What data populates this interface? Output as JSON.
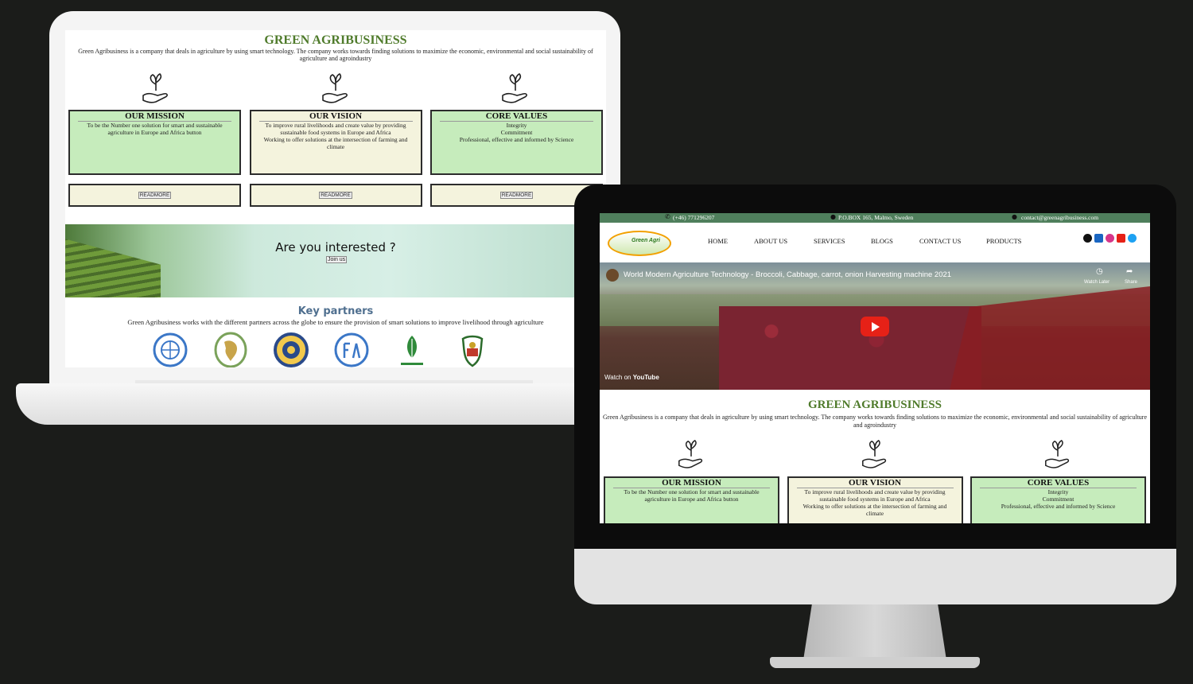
{
  "site": {
    "title": "GREEN AGRIBUSINESS",
    "description": "Green Agribusiness is a company that deals in agriculture by using smart technology. The company works towards finding solutions to maximize the economic, environmental and social sustainability of agriculture and agroindustry",
    "cards": [
      {
        "heading": "OUR MISSION",
        "lines": [
          "To be the Number one solution for smart and sustainable agriculture in Europe and Africa button"
        ],
        "color": "#c6ecbc"
      },
      {
        "heading": "OUR VISION",
        "lines": [
          "To improve rural livelihoods and create value by providing sustainable food systems in Europe and Africa",
          "Working to offer solutions at the intersection of farming and climate"
        ],
        "color": "#f4f3dd"
      },
      {
        "heading": "CORE VALUES",
        "lines": [
          "Integrity",
          "Commitment",
          "Professional, effective and informed by Science"
        ],
        "color": "#c6ecbc"
      }
    ],
    "readmore_label": "READMORE",
    "banner": {
      "heading": "Are you interested ?",
      "button": "Join us"
    },
    "partners": {
      "title": "Key partners",
      "description": "Green Agribusiness works with the different partners across the globe to ensure the provision of smart solutions to improve livelihood through agriculture",
      "logos": [
        "un-logo",
        "african-union-logo",
        "ecowas-logo",
        "fao-logo",
        "organic-logo",
        "emblem-logo"
      ]
    },
    "topbar": {
      "phone": "(+46) 771296207",
      "address": "P.O.BOX 165, Malmo, Sweden",
      "email": "contact@greenagribusiness.com"
    },
    "logo_text": "Green Agri",
    "nav": [
      "HOME",
      "ABOUT US",
      "SERVICES",
      "BLOGS",
      "CONTACT US",
      "PRODUCTS"
    ],
    "social": [
      "facebook-icon",
      "linkedin-icon",
      "instagram-icon",
      "youtube-icon",
      "twitter-icon"
    ],
    "video": {
      "title": "World Modern Agriculture Technology - Broccoli, Cabbage, carrot, onion Harvesting machine 2021",
      "watch_later": "Watch Later",
      "share": "Share",
      "watch_on": "Watch on",
      "youtube": "YouTube"
    }
  },
  "colors": {
    "brand_green": "#4f7b2b",
    "topbar": "#4f7f5c",
    "card_green": "#c6ecbc",
    "card_cream": "#f4f3dd",
    "background": "#1b1c1a"
  }
}
